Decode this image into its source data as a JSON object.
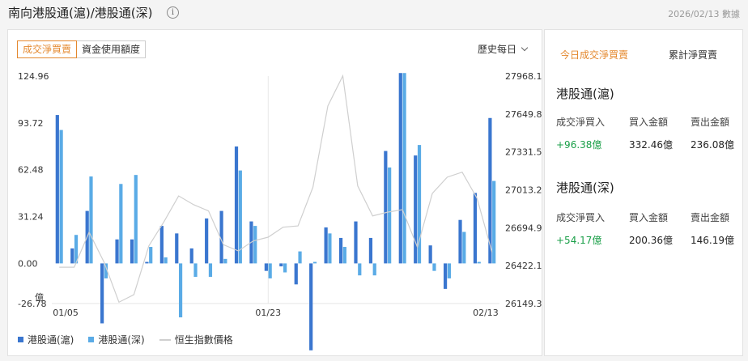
{
  "header": {
    "title": "南向港股通(滬)/港股通(深)",
    "updated": "2026/02/13 數據",
    "info_icon": "info-icon"
  },
  "chart_tabs": [
    {
      "label": "成交淨買賣",
      "active": true
    },
    {
      "label": "資金使用額度",
      "active": false
    }
  ],
  "range_label": "歷史每日",
  "legend": [
    {
      "label": "港股通(滬)",
      "color": "#3a76cf"
    },
    {
      "label": "港股通(深)",
      "color": "#5aabe6"
    },
    {
      "label": "恒生指數價格",
      "color": "#cfcfcf"
    }
  ],
  "chart_data": {
    "type": "bar",
    "unit_label": "億",
    "x": [
      "01/05",
      "01/06",
      "01/07",
      "01/08",
      "01/09",
      "01/12",
      "01/13",
      "01/14",
      "01/15",
      "01/16",
      "01/19",
      "01/20",
      "01/21",
      "01/22",
      "01/23",
      "01/26",
      "01/27",
      "01/28",
      "01/29",
      "01/30",
      "02/02",
      "02/03",
      "02/04",
      "02/05",
      "02/06",
      "02/09",
      "02/10",
      "02/11",
      "02/12",
      "02/13"
    ],
    "x_ticks": [
      "01/05",
      "01/23",
      "02/13"
    ],
    "left_axis": {
      "ticks": [
        "124.96",
        "93.72",
        "62.48",
        "31.24",
        "0.00",
        "-26.78"
      ],
      "ylim": [
        -26.78,
        124.96
      ]
    },
    "right_axis": {
      "ticks": [
        "27968.1",
        "27649.8",
        "27331.5",
        "27013.2",
        "26694.9",
        "26422.1",
        "26149.3"
      ],
      "ylim": [
        26149.3,
        27968.1
      ]
    },
    "series": [
      {
        "name": "港股通(滬)",
        "axis": "left",
        "values": [
          99,
          10,
          35,
          -40,
          16,
          16,
          1,
          25,
          20,
          10,
          30,
          35,
          78,
          28,
          -5,
          -2,
          -14,
          -58,
          24,
          17,
          28,
          17,
          75,
          127,
          72,
          12,
          -17,
          29,
          47,
          97
        ]
      },
      {
        "name": "港股通(深)",
        "axis": "left",
        "values": [
          89,
          19,
          58,
          -10,
          53,
          59,
          11,
          4,
          -36,
          -9,
          -9,
          3,
          62,
          25,
          -10,
          -6,
          8,
          1,
          20,
          11,
          -8,
          -8,
          64,
          127,
          79,
          -5,
          -10,
          21,
          1,
          55
        ]
      },
      {
        "name": "恒生指數價格",
        "axis": "right",
        "values": [
          26440,
          26440,
          26720,
          26480,
          26160,
          26220,
          26610,
          26800,
          27010,
          26940,
          26890,
          26620,
          26570,
          26650,
          26680,
          26760,
          26770,
          27080,
          27730,
          27970,
          27090,
          26850,
          26880,
          26900,
          26600,
          27030,
          27160,
          27200,
          26990,
          26560
        ]
      }
    ]
  },
  "today": {
    "tabs": [
      {
        "label": "今日成交淨買賣",
        "active": true
      },
      {
        "label": "累計淨買賣",
        "active": false
      }
    ],
    "col_net": "成交淨買入",
    "col_buy": "買入金額",
    "col_sell": "賣出金額",
    "sections": [
      {
        "name": "港股通(滬)",
        "net": "+96.38億",
        "buy": "332.46億",
        "sell": "236.08億"
      },
      {
        "name": "港股通(深)",
        "net": "+54.17億",
        "buy": "200.36億",
        "sell": "146.19億"
      }
    ]
  }
}
